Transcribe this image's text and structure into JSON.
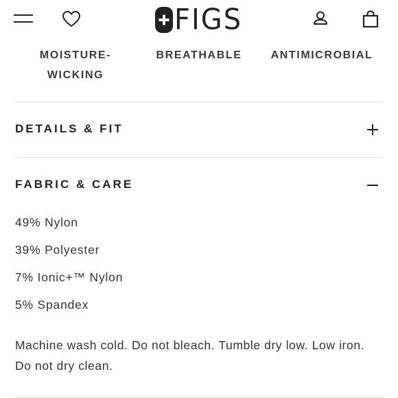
{
  "header": {
    "brand": "FIGS",
    "icons": {
      "menu": "hamburger-menu-icon",
      "wishlist": "heart-icon",
      "account": "user-icon",
      "cart": "shopping-bag-icon"
    }
  },
  "features": [
    {
      "label": "MOISTURE-WICKING"
    },
    {
      "label": "BREATHABLE"
    },
    {
      "label": "ANTIMICROBIAL"
    }
  ],
  "sections": {
    "details_fit": {
      "title": "DETAILS & FIT",
      "expanded": false
    },
    "fabric_care": {
      "title": "FABRIC & CARE",
      "expanded": true,
      "composition": [
        "49% Nylon",
        "39% Polyester",
        "7% Ionic+™ Nylon",
        "5% Spandex"
      ],
      "care_instructions": "Machine wash cold. Do not bleach. Tumble dry low. Low iron. Do not dry clean."
    }
  },
  "colors": {
    "text": "#222222",
    "divider": "#dcdcdc",
    "background": "#ffffff"
  }
}
